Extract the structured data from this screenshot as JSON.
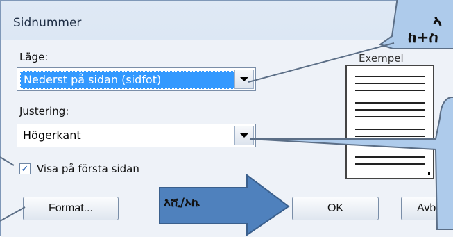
{
  "dialog": {
    "title": "Sidnummer",
    "position_label": "Läge:",
    "position_value": "Nederst på sidan (sidfot)",
    "alignment_label": "Justering:",
    "alignment_value": "Högerkant",
    "show_first_page_label": "Visa på första sidan",
    "show_first_page_checked": true,
    "preview_label": "Exempel",
    "format_button": "Format...",
    "ok_button": "OK",
    "cancel_button": "Avb"
  },
  "annotations": {
    "callout_line1": "ኣ",
    "callout_line2": "ከ+ስ",
    "arrow_text": "እሺ/ኦኬ"
  },
  "colors": {
    "callout_fill": "#aecbeb",
    "selection": "#3399ff",
    "arrow_fill": "#4f81bd"
  }
}
